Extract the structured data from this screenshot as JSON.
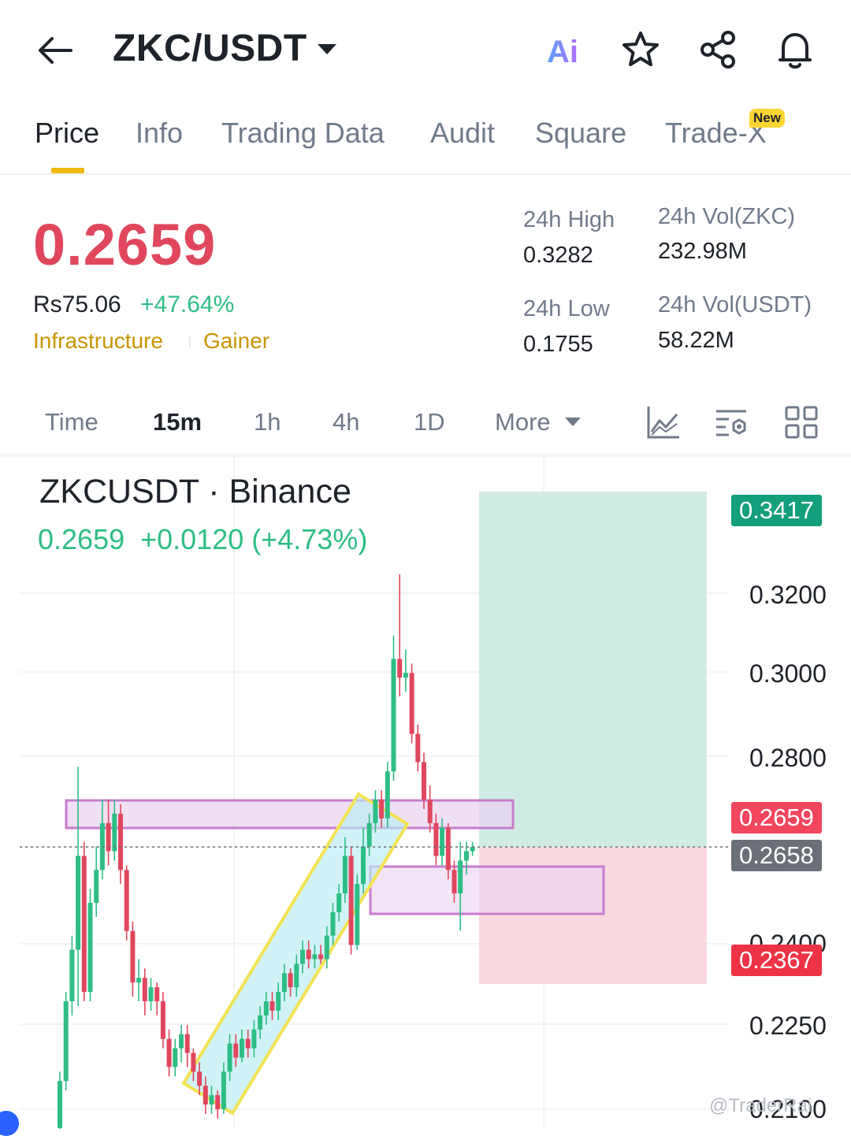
{
  "header": {
    "pair": "ZKC/USDT",
    "ai_label": "Ai"
  },
  "tabs": [
    {
      "label": "Price",
      "active": true
    },
    {
      "label": "Info"
    },
    {
      "label": "Trading Data"
    },
    {
      "label": "Audit"
    },
    {
      "label": "Square"
    },
    {
      "label": "Trade-X",
      "badge": "New"
    }
  ],
  "price": {
    "last": "0.2659",
    "fiat": "Rs75.06",
    "change_pct": "+47.64%",
    "tags": [
      "Infrastructure",
      "Gainer"
    ],
    "color_down": "#e0475d",
    "color_up": "#2ebd85"
  },
  "stats": {
    "high_label": "24h High",
    "high_value": "0.3282",
    "low_label": "24h Low",
    "low_value": "0.1755",
    "vol_base_label": "24h Vol(ZKC)",
    "vol_base_value": "232.98M",
    "vol_quote_label": "24h Vol(USDT)",
    "vol_quote_value": "58.22M"
  },
  "intervals": {
    "items": [
      "Time",
      "15m",
      "1h",
      "4h",
      "1D",
      "More"
    ],
    "selected": "15m"
  },
  "chart_data": {
    "type": "candlestick",
    "symbol": "ZKCUSDT · Binance",
    "quote": "0.2659  +0.0120 (+4.73%)",
    "y_ticks": [
      "0.3200",
      "0.3000",
      "0.2800",
      "0.2400",
      "0.2250",
      "0.2100"
    ],
    "ylim": [
      0.207,
      0.337
    ],
    "price_tags": {
      "take_profit": "0.3417",
      "current": "0.2659",
      "previous": "0.2658",
      "stop_loss": "0.2367"
    },
    "position": {
      "entry": 0.2659,
      "target": 0.3417,
      "stop": 0.2367
    },
    "candles": [
      [
        0.206,
        0.216,
        0.204,
        0.218
      ],
      [
        0.216,
        0.233,
        0.214,
        0.235
      ],
      [
        0.233,
        0.244,
        0.23,
        0.247
      ],
      [
        0.244,
        0.264,
        0.232,
        0.283
      ],
      [
        0.264,
        0.235,
        0.233,
        0.267
      ],
      [
        0.235,
        0.254,
        0.233,
        0.257
      ],
      [
        0.254,
        0.261,
        0.251,
        0.266
      ],
      [
        0.261,
        0.271,
        0.259,
        0.276
      ],
      [
        0.271,
        0.265,
        0.262,
        0.276
      ],
      [
        0.265,
        0.273,
        0.263,
        0.276
      ],
      [
        0.273,
        0.261,
        0.258,
        0.275
      ],
      [
        0.261,
        0.248,
        0.246,
        0.262
      ],
      [
        0.248,
        0.237,
        0.234,
        0.25
      ],
      [
        0.237,
        0.238,
        0.233,
        0.242
      ],
      [
        0.238,
        0.233,
        0.23,
        0.24
      ],
      [
        0.233,
        0.236,
        0.231,
        0.238
      ],
      [
        0.236,
        0.233,
        0.23,
        0.237
      ],
      [
        0.233,
        0.225,
        0.223,
        0.235
      ],
      [
        0.225,
        0.219,
        0.217,
        0.227
      ],
      [
        0.219,
        0.223,
        0.217,
        0.225
      ],
      [
        0.223,
        0.226,
        0.22,
        0.228
      ],
      [
        0.226,
        0.222,
        0.219,
        0.228
      ],
      [
        0.222,
        0.218,
        0.216,
        0.223
      ],
      [
        0.218,
        0.215,
        0.213,
        0.22
      ],
      [
        0.215,
        0.211,
        0.209,
        0.217
      ],
      [
        0.211,
        0.213,
        0.209,
        0.215
      ],
      [
        0.213,
        0.21,
        0.208,
        0.214
      ],
      [
        0.21,
        0.218,
        0.209,
        0.22
      ],
      [
        0.218,
        0.224,
        0.216,
        0.226
      ],
      [
        0.224,
        0.221,
        0.219,
        0.226
      ],
      [
        0.221,
        0.225,
        0.22,
        0.227
      ],
      [
        0.225,
        0.223,
        0.221,
        0.227
      ],
      [
        0.223,
        0.227,
        0.221,
        0.229
      ],
      [
        0.227,
        0.23,
        0.225,
        0.232
      ],
      [
        0.23,
        0.233,
        0.228,
        0.235
      ],
      [
        0.233,
        0.231,
        0.229,
        0.235
      ],
      [
        0.231,
        0.235,
        0.229,
        0.237
      ],
      [
        0.235,
        0.239,
        0.233,
        0.241
      ],
      [
        0.239,
        0.236,
        0.234,
        0.24
      ],
      [
        0.236,
        0.241,
        0.234,
        0.243
      ],
      [
        0.241,
        0.244,
        0.239,
        0.246
      ],
      [
        0.244,
        0.242,
        0.24,
        0.246
      ],
      [
        0.242,
        0.243,
        0.24,
        0.245
      ],
      [
        0.243,
        0.242,
        0.241,
        0.245
      ],
      [
        0.242,
        0.247,
        0.24,
        0.249
      ],
      [
        0.247,
        0.252,
        0.245,
        0.254
      ],
      [
        0.252,
        0.256,
        0.25,
        0.258
      ],
      [
        0.256,
        0.264,
        0.254,
        0.268
      ],
      [
        0.264,
        0.245,
        0.243,
        0.266
      ],
      [
        0.245,
        0.258,
        0.244,
        0.26
      ],
      [
        0.258,
        0.266,
        0.256,
        0.27
      ],
      [
        0.266,
        0.271,
        0.264,
        0.273
      ],
      [
        0.271,
        0.276,
        0.269,
        0.278
      ],
      [
        0.276,
        0.272,
        0.27,
        0.278
      ],
      [
        0.272,
        0.282,
        0.27,
        0.284
      ],
      [
        0.282,
        0.306,
        0.28,
        0.311
      ],
      [
        0.306,
        0.302,
        0.298,
        0.324
      ],
      [
        0.302,
        0.303,
        0.299,
        0.308
      ],
      [
        0.303,
        0.29,
        0.288,
        0.305
      ],
      [
        0.29,
        0.284,
        0.282,
        0.292
      ],
      [
        0.284,
        0.276,
        0.274,
        0.286
      ],
      [
        0.276,
        0.271,
        0.269,
        0.279
      ],
      [
        0.271,
        0.264,
        0.262,
        0.273
      ],
      [
        0.264,
        0.27,
        0.262,
        0.272
      ],
      [
        0.27,
        0.261,
        0.259,
        0.271
      ],
      [
        0.261,
        0.256,
        0.254,
        0.263
      ],
      [
        0.256,
        0.263,
        0.248,
        0.267
      ],
      [
        0.263,
        0.265,
        0.26,
        0.267
      ],
      [
        0.265,
        0.2659,
        0.264,
        0.267
      ]
    ],
    "grid": true
  },
  "watermark": "@TraderRai",
  "colors": {
    "accent": "#f0b90b",
    "up": "#2ebd85",
    "down": "#e0475d",
    "tp_zone": "#cdeae1",
    "sl_zone": "#f9d7dc",
    "channel": "#f3e253",
    "channel_fill": "#b9ecf2",
    "zone_purple": "#c77dce"
  }
}
